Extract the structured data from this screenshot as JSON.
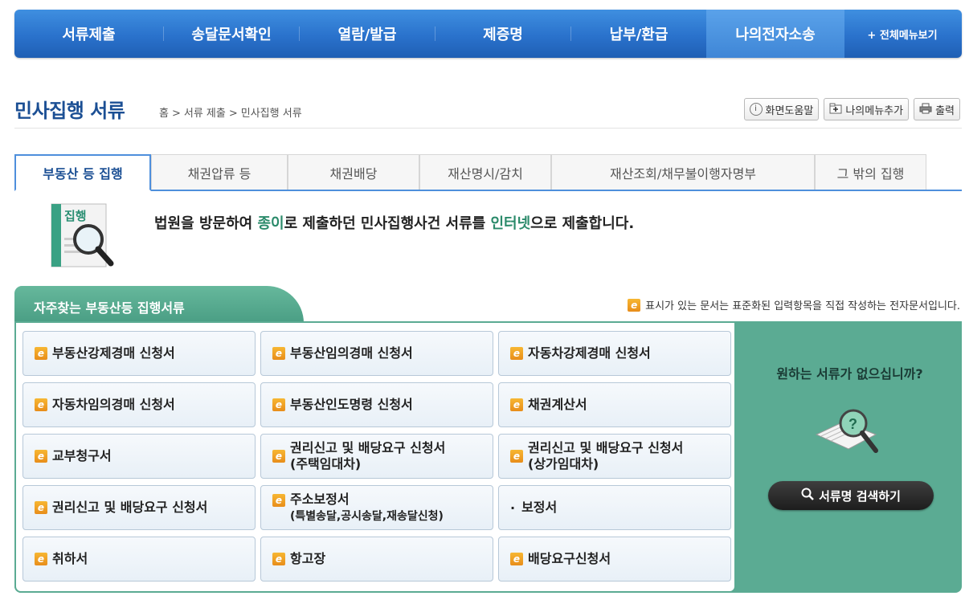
{
  "topnav": {
    "items": [
      {
        "label": "서류제출"
      },
      {
        "label": "송달문서확인"
      },
      {
        "label": "열람/발급"
      },
      {
        "label": "제증명"
      },
      {
        "label": "납부/환급"
      },
      {
        "label": "나의전자소송"
      }
    ],
    "all_menu": "+ 전체메뉴보기"
  },
  "page": {
    "title": "민사집행 서류",
    "breadcrumb": [
      "홈",
      ">",
      "서류 제출",
      ">",
      "민사집행 서류"
    ]
  },
  "tools": {
    "help": "화면도움말",
    "add_menu": "나의메뉴추가",
    "print": "출력"
  },
  "tabs": [
    {
      "label": "부동산 등 집행"
    },
    {
      "label": "채권압류 등"
    },
    {
      "label": "채권배당"
    },
    {
      "label": "재산명시/감치"
    },
    {
      "label": "재산조회/채무불이행자명부"
    },
    {
      "label": "그 밖의 집행"
    }
  ],
  "intro": {
    "icon_label": "집행",
    "text_1": "법원을 방문하여 ",
    "highlight_1": "종이",
    "text_2": "로 제출하던 민사집행사건 서류를 ",
    "highlight_2": "인터넷",
    "text_3": "으로 제출합니다."
  },
  "section": {
    "title": "자주찾는 부동산등 집행서류",
    "legend": "표시가 있는 문서는 표준화된 입력항목을 직접 작성하는 전자문서입니다."
  },
  "docs": [
    {
      "label": "부동산강제경매 신청서",
      "sub": "",
      "electronic": true
    },
    {
      "label": "부동산임의경매 신청서",
      "sub": "",
      "electronic": true
    },
    {
      "label": "자동차강제경매 신청서",
      "sub": "",
      "electronic": true
    },
    {
      "label": "자동차임의경매 신청서",
      "sub": "",
      "electronic": true
    },
    {
      "label": "부동산인도명령 신청서",
      "sub": "",
      "electronic": true
    },
    {
      "label": "채권계산서",
      "sub": "",
      "electronic": true
    },
    {
      "label": "교부청구서",
      "sub": "",
      "electronic": true
    },
    {
      "label": "권리신고 및 배당요구 신청서",
      "sub": "(주택임대차)",
      "electronic": true
    },
    {
      "label": "권리신고 및 배당요구 신청서",
      "sub": "(상가임대차)",
      "electronic": true
    },
    {
      "label": "권리신고 및 배당요구 신청서",
      "sub": "",
      "electronic": true
    },
    {
      "label": "주소보정서",
      "sub": "(특별송달,공시송달,재송달신청)",
      "electronic": true
    },
    {
      "label": "보정서",
      "sub": "",
      "electronic": false
    },
    {
      "label": "취하서",
      "sub": "",
      "electronic": true
    },
    {
      "label": "항고장",
      "sub": "",
      "electronic": true
    },
    {
      "label": "배당요구신청서",
      "sub": "",
      "electronic": true
    }
  ],
  "side": {
    "question": "원하는 서류가 없으십니까?",
    "search_label": "서류명 검색하기"
  },
  "colors": {
    "nav": "#2a72cc",
    "title": "#1b4f94",
    "section": "#5bab93",
    "e_icon": "#f0a028"
  }
}
